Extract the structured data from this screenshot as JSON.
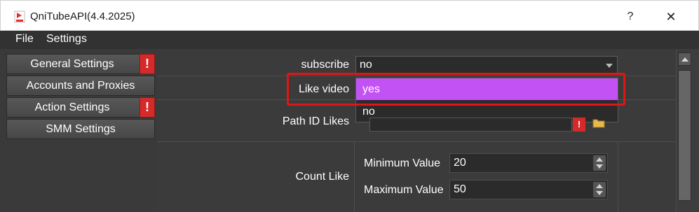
{
  "window": {
    "title": "QniTubeAPI(4.4.2025)",
    "help_label": "?",
    "close_label": "✕"
  },
  "menu": {
    "items": [
      {
        "label": "File"
      },
      {
        "label": "Settings"
      }
    ]
  },
  "sidebar": {
    "items": [
      {
        "label": "General Settings",
        "warning": "!"
      },
      {
        "label": "Accounts and Proxies"
      },
      {
        "label": "Action Settings",
        "warning": "!"
      },
      {
        "label": "SMM Settings"
      }
    ]
  },
  "form": {
    "subscribe": {
      "label": "subscribe",
      "value": "no"
    },
    "like_video": {
      "label": "Like video",
      "options": [
        "yes",
        "no"
      ],
      "highlighted": "yes"
    },
    "path_id_likes": {
      "label": "Path ID Likes",
      "warning": "!"
    },
    "count_like": {
      "label": "Count Like",
      "min_label": "Minimum Value",
      "min_value": "20",
      "max_label": "Maximum Value",
      "max_value": "50"
    }
  },
  "colors": {
    "highlight": "#c352f5",
    "annotation_box": "#e01515",
    "warning": "#d52a2a"
  },
  "icons": [
    "app-icon",
    "folder-icon",
    "chevron-down-icon",
    "spin-up-icon",
    "spin-down-icon"
  ]
}
